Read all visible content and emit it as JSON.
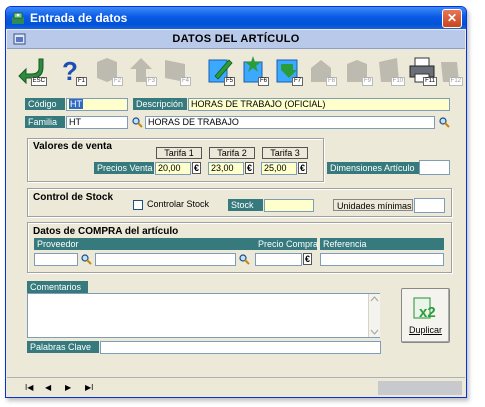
{
  "window": {
    "title": "Entrada de datos",
    "close_glyph": "✕"
  },
  "header": {
    "title": "DATOS DEL ARTÍCULO"
  },
  "toolbar": {
    "buttons": [
      {
        "name": "exit-icon",
        "key": "ESC",
        "enabled": true
      },
      {
        "name": "help-icon",
        "key": "F1",
        "enabled": true
      },
      {
        "name": "first-record-icon",
        "key": "F2",
        "enabled": false
      },
      {
        "name": "prev-record-icon",
        "key": "F3",
        "enabled": false
      },
      {
        "name": "next-record-icon",
        "key": "F4",
        "enabled": false
      },
      {
        "name": "edit-icon",
        "key": "F5",
        "enabled": true
      },
      {
        "name": "new-icon",
        "key": "F6",
        "enabled": true
      },
      {
        "name": "save-icon",
        "key": "F7",
        "enabled": true
      },
      {
        "name": "delete-icon",
        "key": "F8",
        "enabled": false
      },
      {
        "name": "copy-icon",
        "key": "F9",
        "enabled": false
      },
      {
        "name": "paste-icon",
        "key": "F10",
        "enabled": false
      },
      {
        "name": "print-icon",
        "key": "F11",
        "enabled": true
      },
      {
        "name": "tools-icon",
        "key": "F12",
        "enabled": false
      }
    ]
  },
  "form": {
    "codigo_label": "Código",
    "codigo_value": "HT",
    "descripcion_label": "Descripción",
    "descripcion_value": "HORAS DE TRABAJO (OFICIAL)",
    "familia_label": "Familia",
    "familia_code": "HT",
    "familia_name": "HORAS DE TRABAJO"
  },
  "ventas": {
    "group_title": "Valores de venta",
    "tarifa1": "Tarifa 1",
    "tarifa2": "Tarifa 2",
    "tarifa3": "Tarifa 3",
    "precios_label": "Precios Venta",
    "precio1": "20,00",
    "precio2": "23,00",
    "precio3": "25,00",
    "currency": "€",
    "dimensiones_label": "Dimensiones Artículo",
    "dimensiones_value": ""
  },
  "stock": {
    "group_title": "Control de Stock",
    "controlar_label": "Controlar Stock",
    "controlar_checked": false,
    "stock_label": "Stock",
    "stock_value": "",
    "unidades_label": "Unidades mínimas",
    "unidades_value": ""
  },
  "compra": {
    "group_title": "Datos de COMPRA del artículo",
    "proveedor_label": "Proveedor",
    "proveedor_code": "",
    "proveedor_name": "",
    "precio_label": "Precio Compra",
    "precio_value": "",
    "referencia_label": "Referencia",
    "referencia_value": ""
  },
  "comentarios": {
    "label": "Comentarios",
    "value": ""
  },
  "palabras": {
    "label": "Palabras Clave",
    "value": ""
  },
  "duplicar": {
    "label": "Duplicar",
    "icon_text": "x2"
  },
  "navigation": {
    "first": "I◀",
    "prev": "◀",
    "next": "▶",
    "last": "▶I"
  }
}
